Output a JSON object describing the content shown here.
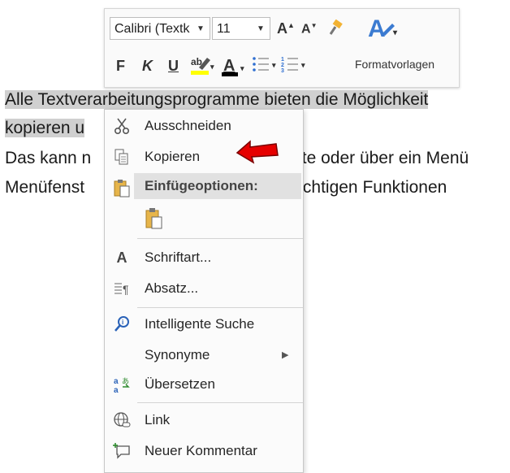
{
  "document": {
    "line1": "Alle Textverarbeitungsprogramme bieten die Möglichkeit",
    "line2": "kopieren u",
    "line3_left": "Das kann n",
    "line3_right": "ste oder über ein Menü",
    "line4_left": "Menüfenst",
    "line4_right": "wichtigen Funktionen"
  },
  "mini_toolbar": {
    "font_name": "Calibri (Textk",
    "font_size": "11",
    "grow_font": "A",
    "shrink_font": "A",
    "bold": "F",
    "italic": "K",
    "underline": "U",
    "font_color": "A",
    "styles_label": "Formatvorlagen",
    "highlight_color": "#ffff00",
    "font_color_value": "#000000"
  },
  "context_menu": {
    "items": [
      {
        "label": "Ausschneiden",
        "icon": "scissors-icon"
      },
      {
        "label": "Kopieren",
        "icon": "copy-icon"
      },
      {
        "label": "Einfügeoptionen:",
        "icon": "clipboard-icon"
      },
      {
        "label": "",
        "icon": "paste-keep-format-icon"
      },
      {
        "label": "Schriftart...",
        "icon": "font-icon"
      },
      {
        "label": "Absatz...",
        "icon": "paragraph-icon"
      },
      {
        "label": "Intelligente Suche",
        "icon": "smart-lookup-icon"
      },
      {
        "label": "Synonyme",
        "icon": ""
      },
      {
        "label": "Übersetzen",
        "icon": "translate-icon"
      },
      {
        "label": "Link",
        "icon": "link-icon"
      },
      {
        "label": "Neuer Kommentar",
        "icon": "comment-icon"
      }
    ]
  },
  "annotation": {
    "color": "#e60000",
    "icon": "red-arrow-icon"
  }
}
